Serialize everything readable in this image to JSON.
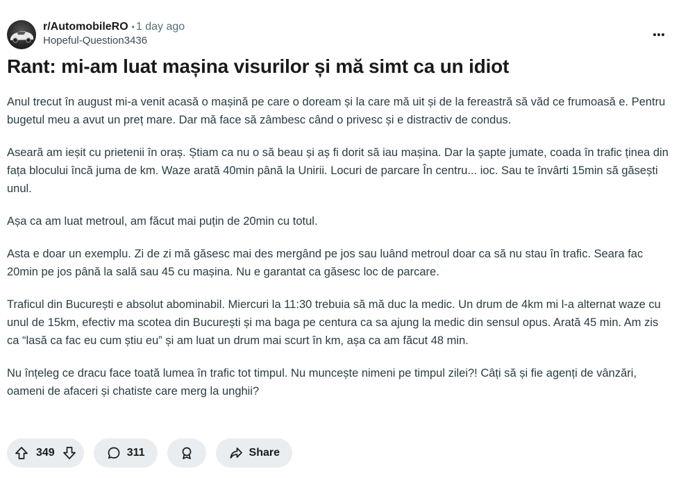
{
  "post": {
    "subreddit": "r/AutomobileRO",
    "separator": "•",
    "time_ago": "1 day ago",
    "author": "Hopeful-Question3436",
    "title": "Rant: mi-am luat mașina visurilor și mă simt ca un idiot",
    "paragraphs": [
      "Anul trecut în august mi-a venit acasă o mașină pe care o doream și la care mă uit și de la fereastră să văd ce frumoasă e. Pentru bugetul meu a avut un preț mare. Dar mă face să zâmbesc când o privesc și e distractiv de condus.",
      "Aseară am ieșit cu prietenii în oraș. Știam ca nu o să beau și aș fi dorit să iau mașina. Dar la șapte jumate, coada în trafic ținea din fața blocului încă juma de km. Waze arată 40min până la Unirii. Locuri de parcare În centru... ioc. Sau te învârti 15min să găsești unul.",
      "Așa ca am luat metroul, am făcut mai puțin de 20min cu totul.",
      "Asta e doar un exemplu. Zi de zi mă găsesc mai des mergând pe jos sau luând metroul doar ca să nu stau în trafic. Seara fac 20min pe jos până la sală sau 45 cu mașina. Nu e garantat ca găsesc loc de parcare.",
      "Traficul din București e absolut abominabil. Miercuri la 11:30 trebuia să mă duc la medic. Un drum de 4km mi l-a alternat waze cu unul de 15km, efectiv ma scotea din București și ma baga pe centura ca sa ajung la medic din sensul opus. Arată 45 min. Am zis ca “lasă ca fac eu cum știu eu” și am luat un drum mai scurt în km, așa ca am făcut 48 min.",
      "Nu înțeleg ce dracu face toată lumea în trafic tot timpul. Nu muncește nimeni pe timpul zilei?! Câți să și fie agenți de vânzări, oameni de afaceri și chatiste care merg la unghii?"
    ]
  },
  "actions": {
    "upvotes": "349",
    "comments": "311",
    "share_label": "Share"
  },
  "icons": {
    "upvote": "arrow-up-icon",
    "downvote": "arrow-down-icon",
    "comment": "speech-bubble-icon",
    "award": "award-icon",
    "share": "share-arrow-icon",
    "more": "ellipsis-icon"
  }
}
